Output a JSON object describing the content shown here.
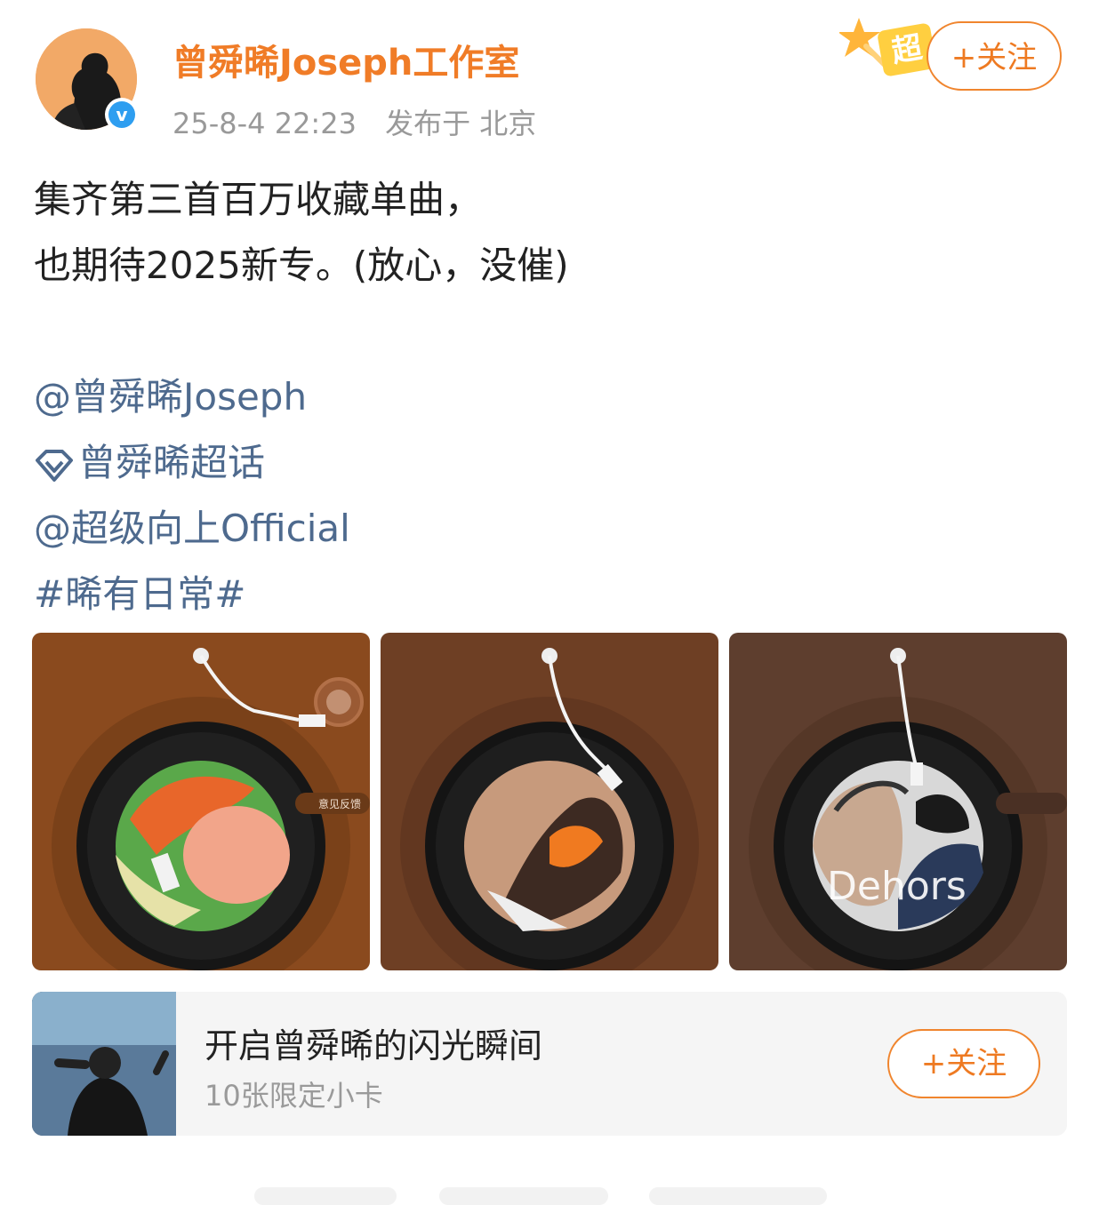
{
  "post": {
    "author": "曾舜晞Joseph工作室",
    "timestamp": "25-8-4 22:23",
    "location": "发布于 北京",
    "verified_icon": "verified-v-icon",
    "super_badge": "超",
    "follow_label": "+关注"
  },
  "content": {
    "line1": "集齐第三首百万收藏单曲，",
    "line2": "也期待2025新专。(放心，没催)",
    "mention1": "@曾舜晞Joseph",
    "supertopic": "曾舜晞超话",
    "mention2": "@超级向上Official",
    "hashtag": "#晞有日常#"
  },
  "images": [
    {
      "name": "vinyl-record-1",
      "feedback_label": "意见反馈"
    },
    {
      "name": "vinyl-record-2"
    },
    {
      "name": "vinyl-record-3",
      "cover_text": "Dehors"
    }
  ],
  "promo_card": {
    "title": "开启曾舜晞的闪光瞬间",
    "subtitle": "10张限定小卡",
    "follow_label": "+关注"
  },
  "colors": {
    "accent": "#f07c27",
    "link": "#4e6a8e",
    "verified": "#2e9ef0"
  }
}
